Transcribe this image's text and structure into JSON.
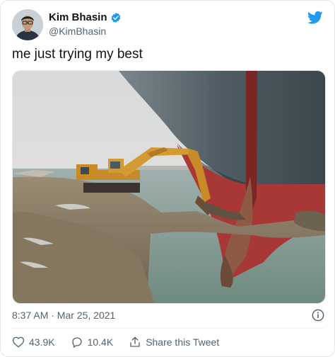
{
  "user": {
    "name": "Kim Bhasin",
    "handle": "@KimBhasin"
  },
  "tweet": {
    "text": "me just trying my best",
    "timestamp": "8:37 AM · Mar 25, 2021"
  },
  "actions": {
    "likes": "43.9K",
    "replies": "10.4K",
    "share_label": "Share this Tweet"
  },
  "colors": {
    "brand": "#1d9bf0",
    "text_primary": "#0f1419",
    "text_secondary": "#536471"
  },
  "icons": [
    "verified-badge-icon",
    "twitter-bird-icon",
    "info-icon",
    "heart-icon",
    "reply-bubble-icon",
    "share-icon"
  ]
}
